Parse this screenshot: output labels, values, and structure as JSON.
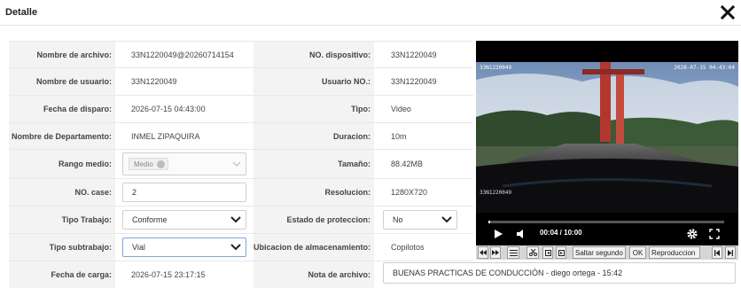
{
  "dialog": {
    "title": "Detalle",
    "close_icon": "close-x-icon"
  },
  "labels": {
    "nombre_archivo": "Nombre de archivo:",
    "no_dispositivo": "NO. dispositivo:",
    "nombre_usuario": "Nombre de usuario:",
    "usuario_no": "Usuario NO.:",
    "fecha_disparo": "Fecha de disparo:",
    "tipo": "Tipo:",
    "nombre_departamento": "Nombre de Departamento:",
    "duracion": "Duracion:",
    "rango_medio": "Rango medio:",
    "tamano": "Tamaño:",
    "no_case": "NO. case:",
    "resolucion": "Resolucion:",
    "tipo_trabajo": "Tipo Trabajo:",
    "estado_proteccion": "Estado de proteccion:",
    "tipo_subtrabajo": "Tipo subtrabajo:",
    "ubicacion": "Ubicacion de almacenamiento:",
    "fecha_carga": "Fecha de carga:",
    "nota_archivo": "Nota de archivo:"
  },
  "values": {
    "nombre_archivo": "33N1220049@20260714154",
    "no_dispositivo": "33N1220049",
    "nombre_usuario": "33N1220049",
    "usuario_no": "33N1220049",
    "fecha_disparo": "2026-07-15 04:43:00",
    "tipo": "Video",
    "nombre_departamento": "INMEL ZIPAQUIRA",
    "duracion": "10m",
    "rango_medio_chip": "Medio",
    "tamano": "88.42MB",
    "no_case": "2",
    "resolucion": "1280X720",
    "tipo_trabajo": "Conforme",
    "estado_proteccion": "No",
    "tipo_subtrabajo": "Vial",
    "ubicacion": "Copilotos",
    "fecha_carga": "2026-07-15 23:17:15",
    "nota_archivo": "BUENAS PRACTICAS DE CONDUCCIÓN - diego ortega - 15:42"
  },
  "video": {
    "overlay_id": "33N1220049",
    "overlay_timestamp": "2026-07-15 04:43:04",
    "overlay_sub": "33N1220049",
    "time": "00:04 / 10:00",
    "progress_fraction": 0.007
  },
  "toolbar": {
    "skip_label": "Saltar segundo",
    "ok_label": "OK",
    "playback_label": "Reproduccion"
  }
}
